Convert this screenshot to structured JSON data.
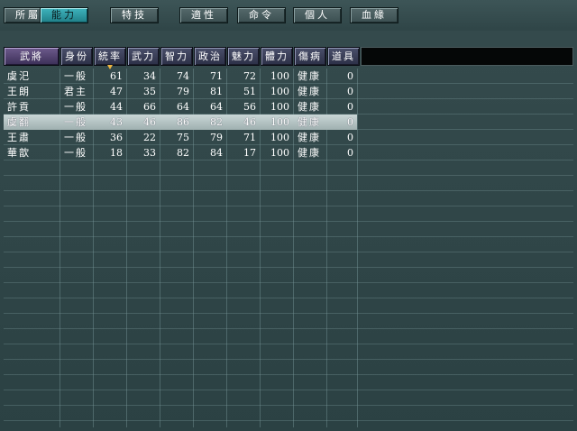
{
  "tabs": [
    {
      "label": "所屬",
      "active": false
    },
    {
      "label": "能力",
      "active": true
    },
    {
      "label": "特技",
      "active": false
    },
    {
      "label": "適性",
      "active": false
    },
    {
      "label": "命令",
      "active": false
    },
    {
      "label": "個人",
      "active": false
    },
    {
      "label": "血緣",
      "active": false
    }
  ],
  "columns": [
    "武將",
    "身份",
    "統率",
    "武力",
    "智力",
    "政治",
    "魅力",
    "體力",
    "傷病",
    "道具"
  ],
  "sorted_column": "統率",
  "rows": [
    {
      "name": "虞汜",
      "status": "一般",
      "leadership": "61",
      "war": "34",
      "intelligence": "74",
      "politics": "71",
      "charm": "72",
      "hp": "100",
      "health": "健康",
      "items": "0"
    },
    {
      "name": "王朗",
      "status": "君主",
      "leadership": "47",
      "war": "35",
      "intelligence": "79",
      "politics": "81",
      "charm": "51",
      "hp": "100",
      "health": "健康",
      "items": "0"
    },
    {
      "name": "許貢",
      "status": "一般",
      "leadership": "44",
      "war": "66",
      "intelligence": "64",
      "politics": "64",
      "charm": "56",
      "hp": "100",
      "health": "健康",
      "items": "0"
    },
    {
      "name": "虞翻",
      "status": "一般",
      "leadership": "43",
      "war": "46",
      "intelligence": "86",
      "politics": "82",
      "charm": "46",
      "hp": "100",
      "health": "健康",
      "items": "0",
      "selected": true
    },
    {
      "name": "王肅",
      "status": "一般",
      "leadership": "36",
      "war": "22",
      "intelligence": "75",
      "politics": "79",
      "charm": "71",
      "hp": "100",
      "health": "健康",
      "items": "0"
    },
    {
      "name": "華歆",
      "status": "一般",
      "leadership": "18",
      "war": "33",
      "intelligence": "82",
      "politics": "84",
      "charm": "17",
      "hp": "100",
      "health": "健康",
      "items": "0"
    }
  ],
  "colors": {
    "active_tab": "#2a9aa3",
    "selected_row": "#b5c4c4",
    "sort_arrow": "#f0b640"
  }
}
